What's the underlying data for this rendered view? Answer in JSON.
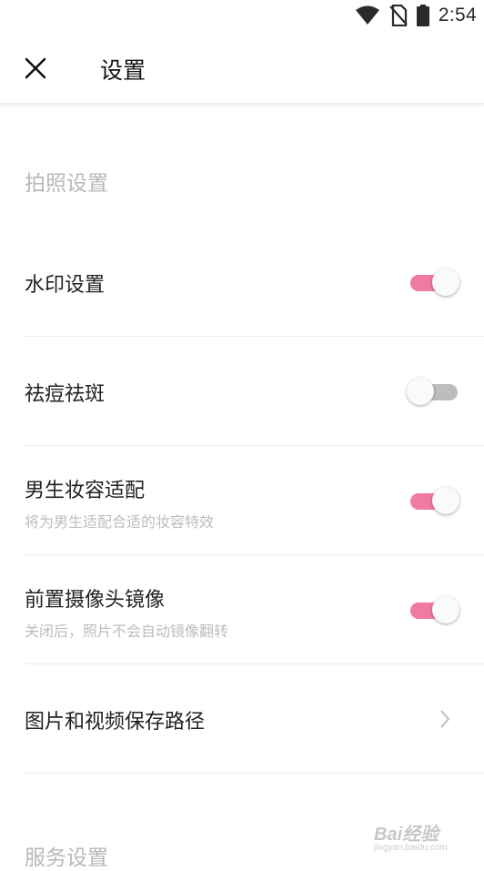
{
  "status_bar": {
    "time": "2:54",
    "icons": [
      "wifi-icon",
      "no-sim-icon",
      "battery-icon"
    ]
  },
  "app_bar": {
    "close_icon": "close-icon",
    "title": "设置"
  },
  "sections": {
    "photo": {
      "header": "拍照设置",
      "items": [
        {
          "title": "水印设置",
          "subtitle": "",
          "control": "toggle",
          "on": true
        },
        {
          "title": "祛痘祛斑",
          "subtitle": "",
          "control": "toggle",
          "on": false
        },
        {
          "title": "男生妆容适配",
          "subtitle": "将为男生适配合适的妆容特效",
          "control": "toggle",
          "on": true
        },
        {
          "title": "前置摄像头镜像",
          "subtitle": "关闭后，照片不会自动镜像翻转",
          "control": "toggle",
          "on": true
        },
        {
          "title": "图片和视频保存路径",
          "subtitle": "",
          "control": "chevron",
          "icon": "chevron-right-icon"
        }
      ]
    },
    "service": {
      "header": "服务设置"
    }
  },
  "watermark": {
    "main": "Bai经验",
    "sub": "jingyan.baidu.com"
  },
  "colors": {
    "toggle_on": "#f07aa0",
    "toggle_off": "#bdbdbd",
    "section_header": "#b8b8b8",
    "subtitle": "#bdbdbd",
    "divider": "#ececec"
  }
}
